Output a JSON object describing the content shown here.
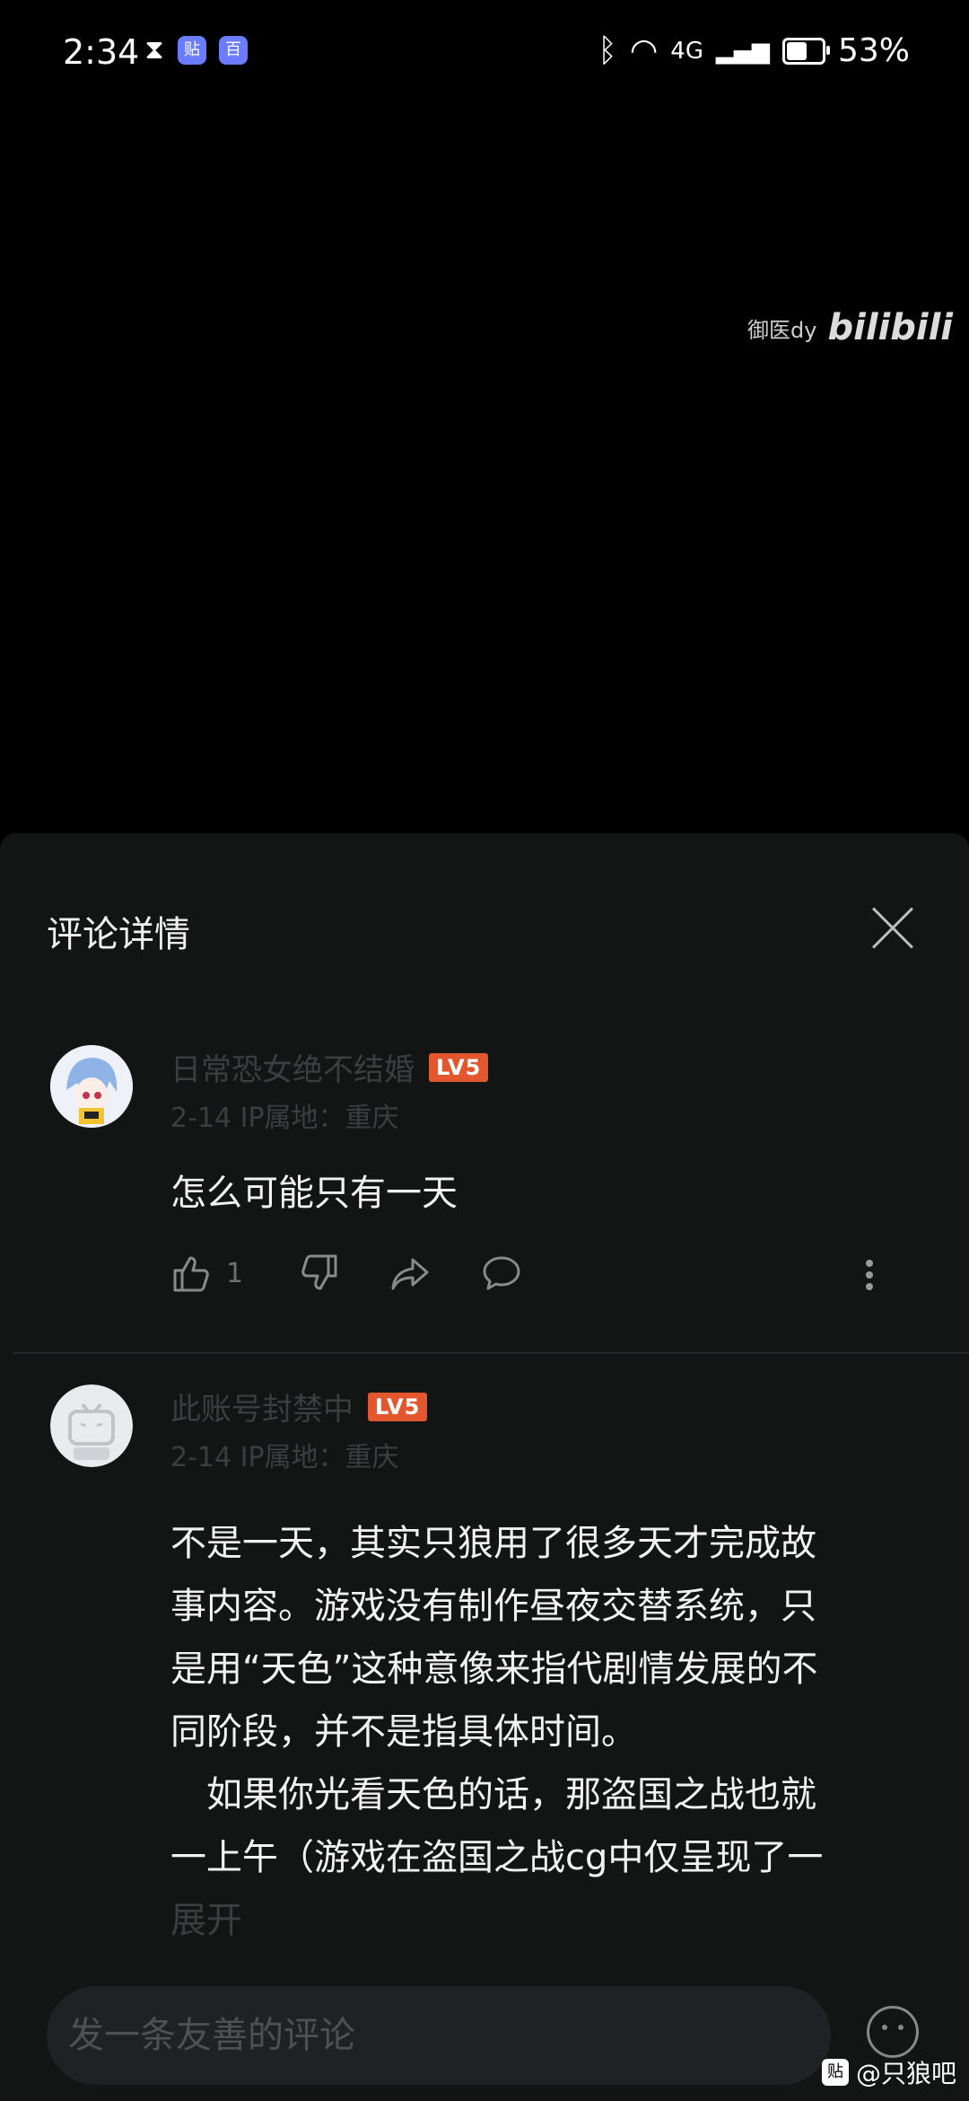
{
  "status": {
    "time": "2:34",
    "icon_tieba": "贴",
    "icon_baidu": "百",
    "network": "4G",
    "battery_pct": "53%",
    "battery_level": 0.53
  },
  "video": {
    "watermark_user": "御医dy",
    "watermark_logo": "bilibili"
  },
  "sheet": {
    "title": "评论详情"
  },
  "comments": [
    {
      "name": "日常恐女绝不结婚",
      "level": "LV5",
      "meta": "2-14 IP属地：重庆",
      "text": "怎么可能只有一天",
      "likes": "1"
    },
    {
      "name": "此账号封禁中",
      "level": "LV5",
      "meta": "2-14 IP属地：重庆",
      "text_lines": [
        "不是一天，其实只狼用了很多天才完成故",
        "事内容。游戏没有制作昼夜交替系统，只",
        "是用“天色”这种意像来指代剧情发展的不",
        "同阶段，并不是指具体时间。",
        "　如果你光看天色的话，那盗国之战也就",
        "一上午（游戏在盗国之战cg中仅呈现了一",
        "展开"
      ]
    }
  ],
  "input": {
    "placeholder": "发一条友善的评论"
  },
  "footer": {
    "badge": "贴",
    "source": "@只狼吧"
  }
}
